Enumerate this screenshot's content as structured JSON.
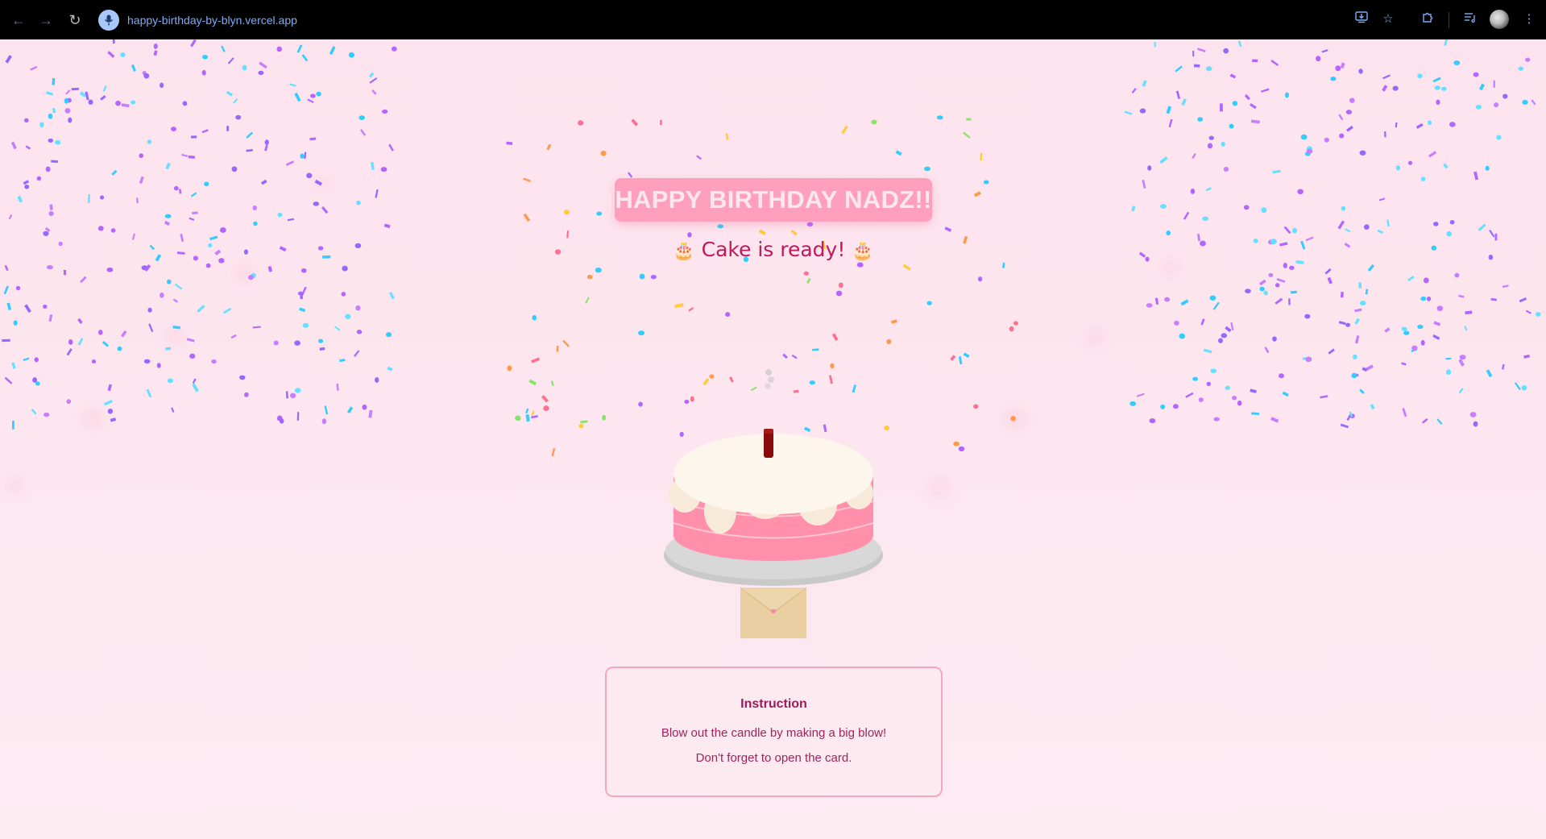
{
  "browser": {
    "url": "happy-birthday-by-blyn.vercel.app",
    "icons": {
      "back": "back-arrow-icon",
      "forward": "forward-arrow-icon",
      "reload": "reload-icon",
      "site_info": "microphone-icon",
      "install": "install-app-icon",
      "bookmark": "star-icon",
      "extensions": "puzzle-icon",
      "media": "media-controls-icon",
      "profile": "avatar",
      "menu": "kebab-menu-icon"
    }
  },
  "page": {
    "title": "HAPPY BIRTHDAY NADZ!!",
    "subtitle_text": "Cake is ready!",
    "subtitle_emoji": "🎂",
    "instruction": {
      "heading": "Instruction",
      "line1": "Blow out the candle by making a big blow!",
      "line2": "Don't forget to open the card."
    }
  },
  "colors": {
    "background": "#fde4ee",
    "title_bg": "#fea0bd",
    "title_text": "#fde8ef",
    "subtitle_text": "#c2185b",
    "cake_pink": "#ff8fab",
    "frosting": "#fdf6ec",
    "candle": "#8b0a0a",
    "plate": "#cfcfcf",
    "envelope": "#e9cfa2",
    "instruction_border": "#f6a5c0",
    "instruction_text": "#9c1b5a",
    "confetti": [
      "#b266ff",
      "#33ccff",
      "#9966ff",
      "#66e0ff",
      "#ff6f91",
      "#ffcc33",
      "#88e36b",
      "#ff9a4d",
      "#c77dff"
    ]
  }
}
